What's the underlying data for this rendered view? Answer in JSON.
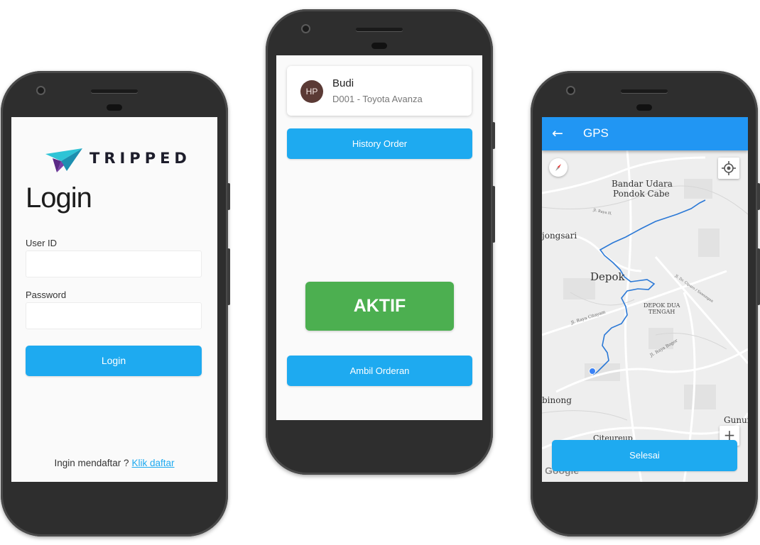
{
  "login_screen": {
    "logo_text": "TRIPPED",
    "title": "Login",
    "user_id_label": "User ID",
    "user_id_value": "",
    "password_label": "Password",
    "password_value": "",
    "login_button": "Login",
    "register_prompt": "Ingin mendaftar ?",
    "register_link": "Klik daftar"
  },
  "driver_screen": {
    "avatar_initials": "HP",
    "driver_name": "Budi",
    "vehicle": "D001 - Toyota Avanza",
    "history_button": "History Order",
    "status_label": "AKTIF",
    "take_order_button": "Ambil Orderan"
  },
  "gps_screen": {
    "title": "GPS",
    "back_icon": "arrow-back-icon",
    "map_labels": {
      "airport_line1": "Bandar Udara",
      "airport_line2": "Pondok Cabe",
      "jongsari": "jongsari",
      "depok": "Depok",
      "depok_dua_line1": "DEPOK DUA",
      "depok_dua_line2": "TENGAH",
      "binong": "binong",
      "gunung": "Gunun",
      "citeureup": "Citeureup",
      "road_citayam": "Jl. Raya Citayam",
      "road_bogor": "Jl. Raya Bogor",
      "road_dr": "Jl. Dr. Cipuro / Sawangan",
      "road_h": "Jl. Raya H."
    },
    "zoom_in": "+",
    "attribution": "Google",
    "finish_button": "Selesai"
  },
  "colors": {
    "primary_blue": "#1eaaf0",
    "appbar_blue": "#2196f3",
    "active_green": "#4caf50",
    "route_blue": "#2a78d6"
  }
}
